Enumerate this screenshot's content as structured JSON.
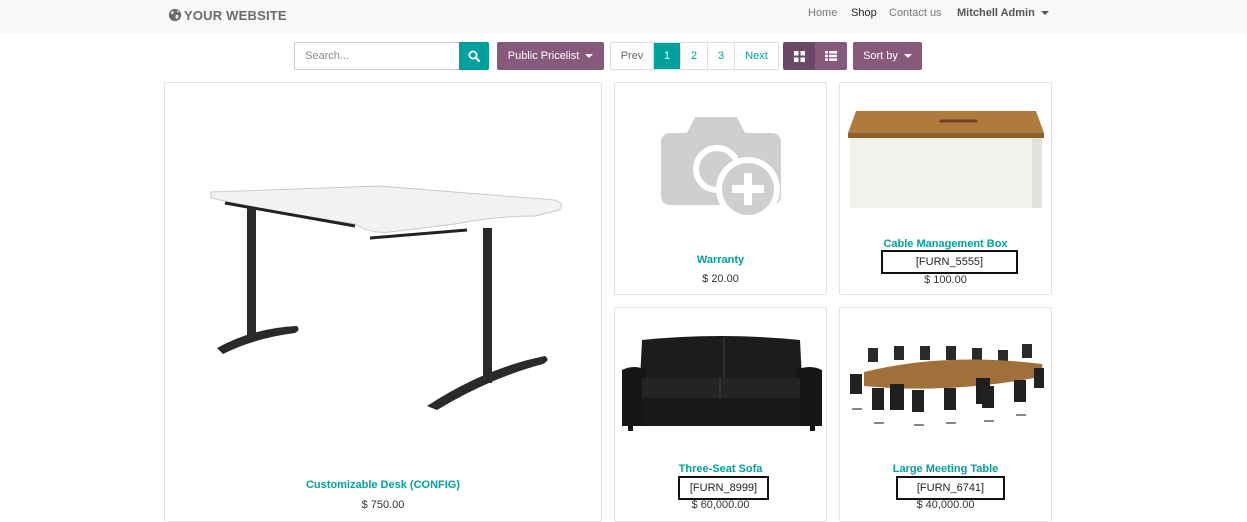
{
  "header": {
    "brand": "YOUR WEBSITE",
    "nav": [
      "Home",
      "Shop",
      "Contact us"
    ],
    "user": "Mitchell Admin"
  },
  "toolbar": {
    "search_placeholder": "Search...",
    "pricelist_label": "Public Pricelist",
    "pager": {
      "prev": "Prev",
      "pages": [
        "1",
        "2",
        "3"
      ],
      "current": "1",
      "next": "Next"
    },
    "sort_label": "Sort by"
  },
  "products": [
    {
      "name": "Customizable Desk (CONFIG)",
      "code": "",
      "price": "$ 750.00"
    },
    {
      "name": "Warranty",
      "code": "",
      "price": "$ 20.00"
    },
    {
      "name": "Cable Management Box",
      "code": "[FURN_5555]",
      "price": "$ 100.00"
    },
    {
      "name": "Three-Seat Sofa",
      "code": "[FURN_8999]",
      "price": "$ 60,000.00"
    },
    {
      "name": "Large Meeting Table",
      "code": "[FURN_6741]",
      "price": "$ 40,000.00"
    }
  ],
  "colors": {
    "primary": "#875a7b",
    "accent": "#00a09d"
  }
}
